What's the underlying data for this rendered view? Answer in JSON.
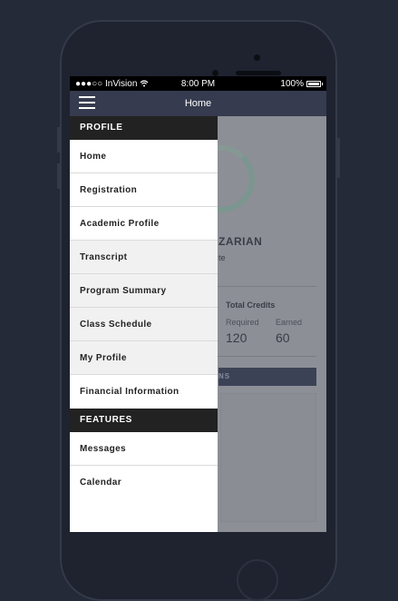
{
  "status_bar": {
    "carrier": "●●●○○ InVision",
    "wifi_icon": "wifi-icon",
    "time": "8:00 PM",
    "battery": "100%"
  },
  "nav": {
    "title": "Home",
    "menu_icon": "hamburger-icon"
  },
  "drawer": {
    "profile_header": "PROFILE",
    "profile_items": [
      {
        "label": "Home"
      },
      {
        "label": "Registration"
      },
      {
        "label": "Academic Profile"
      },
      {
        "label": "Transcript"
      },
      {
        "label": "Program Summary"
      },
      {
        "label": "Class Schedule"
      },
      {
        "label": "My Profile"
      },
      {
        "label": "Financial Information"
      }
    ],
    "features_header": "FEATURES",
    "features_items": [
      {
        "label": "Messages"
      },
      {
        "label": "Calendar"
      }
    ]
  },
  "background": {
    "name_fragment": "ZARIAN",
    "subtitle_fragment": "te",
    "credits": {
      "title": "Total Credits",
      "required_label": "Required",
      "required_value": "120",
      "earned_label": "Earned",
      "earned_value": "60"
    },
    "section_bar_fragment": "NS"
  }
}
